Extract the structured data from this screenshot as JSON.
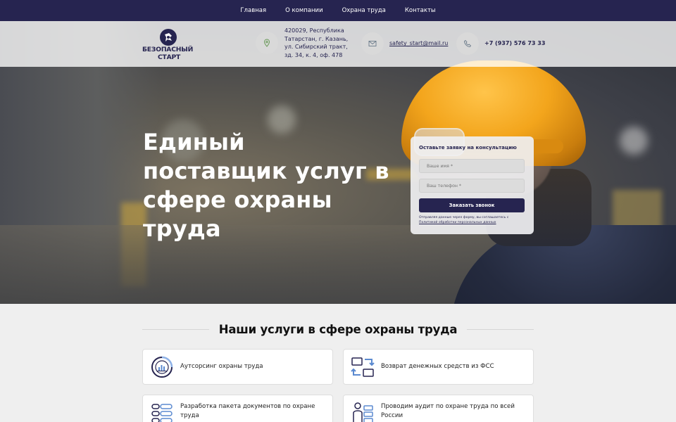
{
  "nav": {
    "items": [
      "Главная",
      "О компании",
      "Охрана труда",
      "Контакты"
    ]
  },
  "header": {
    "logo_line1": "БЕЗОПАСНЫЙ",
    "logo_line2": "СТАРТ",
    "address": "420029, Республика Татарстан, г. Казань, ул. Сибирский тракт, зд. 34, к. 4, оф. 478",
    "email": "safety_start@mail.ru",
    "phone": "+7 (937) 576 73 33",
    "icons": [
      "location-icon",
      "mail-icon",
      "phone-icon"
    ]
  },
  "hero": {
    "title": "Единый поставщик услуг в сфере охраны труда"
  },
  "form": {
    "title": "Оставьте заявку на консультацию",
    "name_placeholder": "Ваше имя *",
    "phone_placeholder": "Ваш телефон *",
    "submit_label": "Заказать звонок",
    "note_text": "Отправляя данные через форму, вы соглашаетесь с ",
    "note_link": "Политикой обработки персональных данных"
  },
  "services": {
    "heading": "Наши услуги в сфере охраны труда",
    "cards": [
      {
        "label": "Аутсорсинг охраны труда",
        "icon": "outsourcing-chart-icon"
      },
      {
        "label": "Возврат денежных средств из ФСС",
        "icon": "money-return-icon"
      },
      {
        "label": "Разработка пакета документов по охране труда",
        "icon": "documents-list-icon"
      },
      {
        "label": "Проводим аудит по охране труда по всей России",
        "icon": "audit-person-icon"
      }
    ]
  },
  "colors": {
    "brand": "#262450",
    "helmet": "#f3a51c",
    "page_bg": "#efefef"
  }
}
